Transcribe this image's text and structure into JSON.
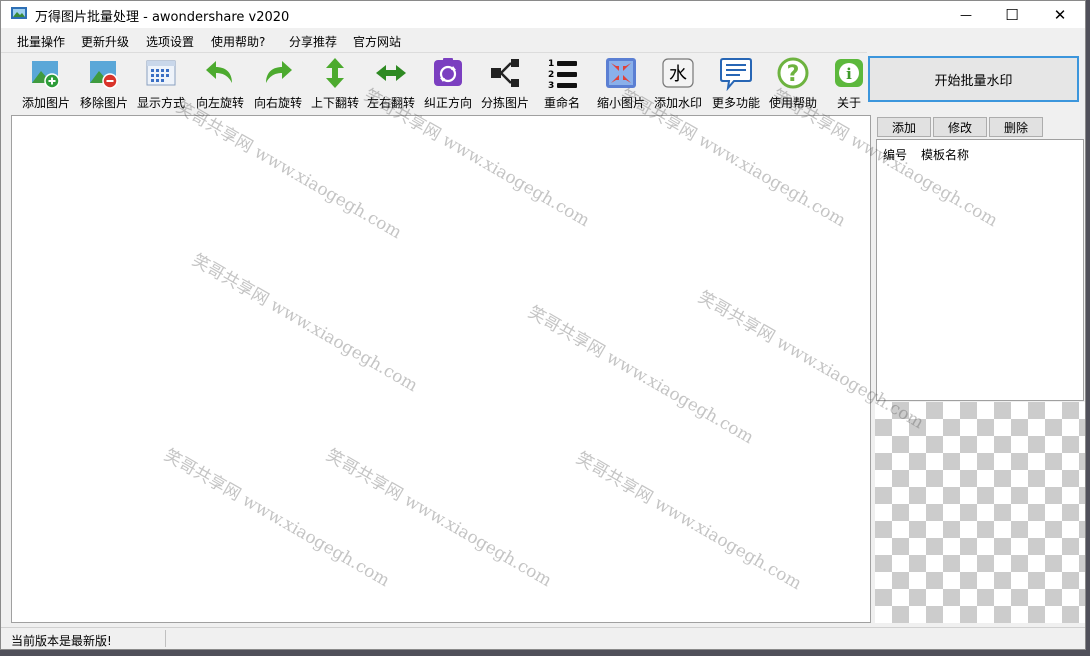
{
  "window": {
    "title": "万得图片批量处理 - awondershare v2020",
    "minimize_glyph": "—",
    "maximize_glyph": "☐",
    "close_glyph": "✕"
  },
  "menubar": {
    "items": [
      "批量操作",
      "更新升级",
      "选项设置",
      "使用帮助?",
      "分享推荐",
      "官方网站"
    ]
  },
  "toolbar": {
    "items": [
      {
        "label": "添加图片",
        "icon": "add-image-icon"
      },
      {
        "label": "移除图片",
        "icon": "remove-image-icon"
      },
      {
        "label": "显示方式",
        "icon": "grid-view-icon"
      },
      {
        "label": "向左旋转",
        "icon": "rotate-left-icon"
      },
      {
        "label": "向右旋转",
        "icon": "rotate-right-icon"
      },
      {
        "label": "上下翻转",
        "icon": "flip-vertical-icon"
      },
      {
        "label": "左右翻转",
        "icon": "flip-horizontal-icon"
      },
      {
        "label": "纠正方向",
        "icon": "correct-orientation-icon"
      },
      {
        "label": "分拣图片",
        "icon": "sort-images-icon"
      },
      {
        "label": "重命名",
        "icon": "rename-icon"
      },
      {
        "label": "缩小图片",
        "icon": "shrink-image-icon"
      },
      {
        "label": "添加水印",
        "icon": "add-watermark-icon"
      },
      {
        "label": "更多功能",
        "icon": "more-features-icon"
      },
      {
        "label": "使用帮助",
        "icon": "help-icon"
      },
      {
        "label": "关于",
        "icon": "about-icon"
      }
    ],
    "rename_numbers": [
      "1",
      "2",
      "3"
    ],
    "watermark_glyph": "水",
    "help_glyph": "?",
    "about_glyph": "i"
  },
  "start_button": {
    "label": "开始批量水印"
  },
  "template_panel": {
    "add_label": "添加",
    "edit_label": "修改",
    "delete_label": "删除",
    "columns": [
      "编号",
      "模板名称"
    ]
  },
  "status": {
    "text": "当前版本是最新版!"
  },
  "overlay_watermarks": [
    "笑哥共享网 www.xiaogegh.com",
    "笑哥共享网 www.xiaogegh.com",
    "笑哥共享网 www.xiaogegh.com",
    "笑哥共享网 www.xiaogegh.com",
    "笑哥共享网 www.xiaogegh.com",
    "笑哥共享网 www.xiaogegh.com",
    "笑哥共享网 www.xiaogegh.com",
    "笑哥共享网 www.xiaogegh.com",
    "笑哥共享网 www.xiaogegh.com",
    "笑哥共享网 www.xiaogegh.com"
  ],
  "colors": {
    "accent_border": "#3c96dc",
    "green_arrow": "#4caa2e",
    "purple": "#7b3fc0"
  }
}
